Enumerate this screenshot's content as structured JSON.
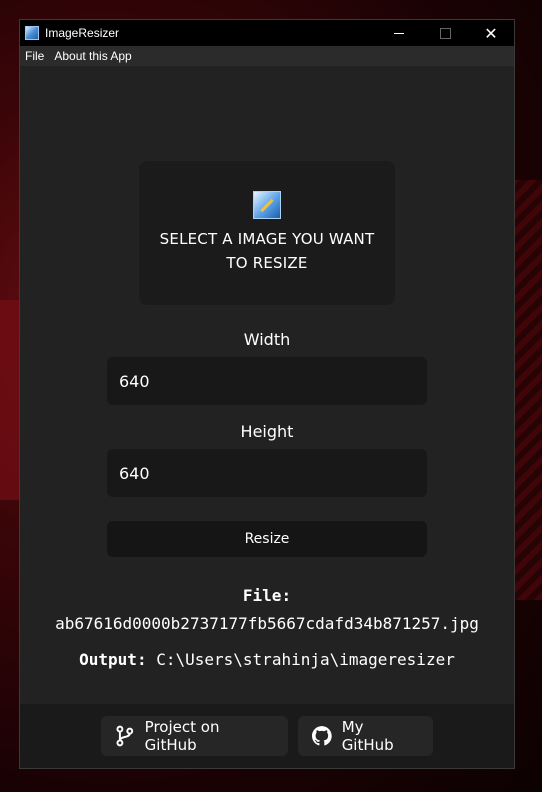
{
  "window": {
    "title": "ImageResizer"
  },
  "menu": {
    "items": [
      "File",
      "About this App"
    ]
  },
  "dropzone": {
    "text": "SELECT A IMAGE YOU WANT TO RESIZE"
  },
  "width": {
    "label": "Width",
    "value": "640"
  },
  "height": {
    "label": "Height",
    "value": "640"
  },
  "resize_button": {
    "label": "Resize"
  },
  "file": {
    "label": "File:",
    "name": "ab67616d0000b2737177fb5667cdafd34b871257.jpg"
  },
  "output": {
    "label": "Output:",
    "path": "C:\\Users\\strahinja\\imageresizer"
  },
  "footer": {
    "project_button": {
      "label": "Project on GitHub",
      "icon": "git-branch-icon"
    },
    "my_github_button": {
      "label": "My GitHub",
      "icon": "github-icon"
    }
  }
}
